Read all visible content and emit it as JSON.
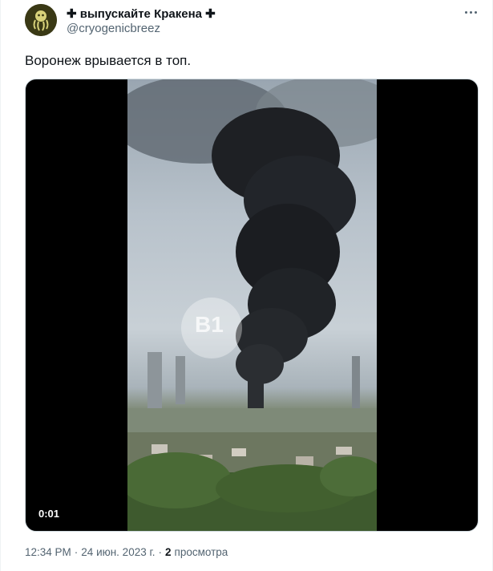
{
  "author": {
    "display_name": "✚ выпускайте Кракена ✚",
    "handle": "@cryogenicbreez",
    "avatar_icon": "kraken-avatar-icon"
  },
  "tweet": {
    "text": "Воронеж врывается в топ."
  },
  "media": {
    "type": "video",
    "duration": "0:01",
    "watermark_text": "В1"
  },
  "meta": {
    "time": "12:34 PM",
    "separator": "·",
    "date": "24 июн. 2023 г.",
    "separator2": "·",
    "views_count": "2",
    "views_label": "просмотра"
  },
  "icons": {
    "more": "more-horizontal-icon"
  },
  "colors": {
    "text_primary": "#0f1419",
    "text_secondary": "#536471",
    "border": "#cfd9de"
  }
}
